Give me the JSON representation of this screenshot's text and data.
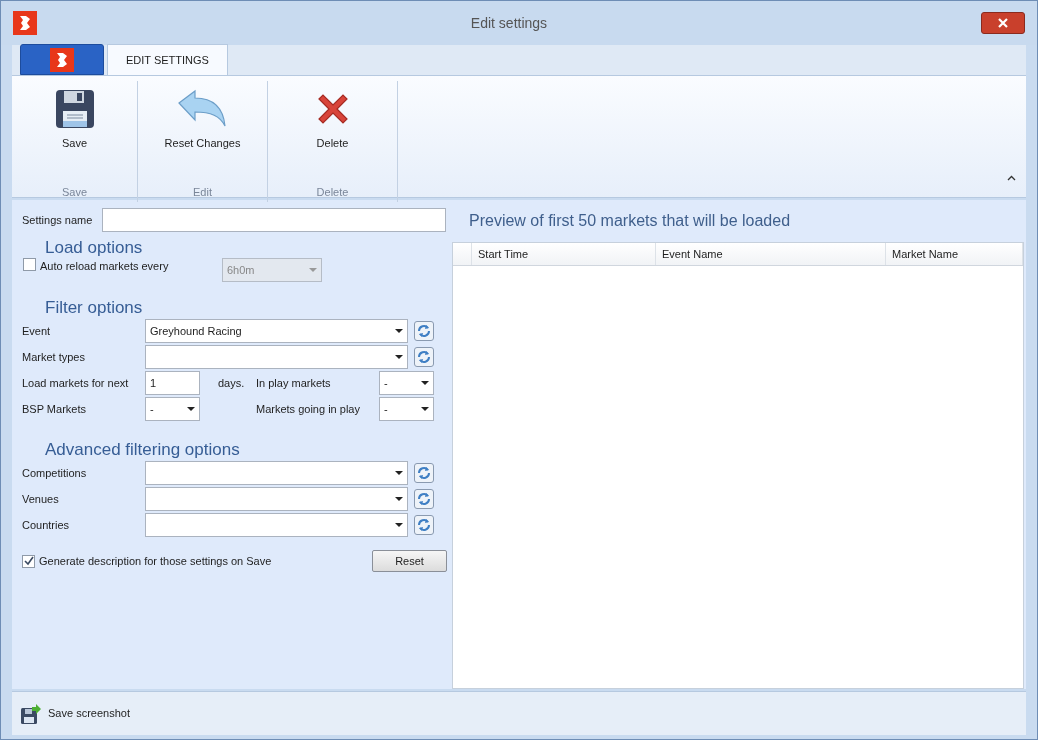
{
  "window": {
    "title": "Edit settings"
  },
  "tabs": [
    {
      "label": "EDIT SETTINGS",
      "selected": true
    }
  ],
  "ribbon": [
    {
      "label": "Save",
      "button": {
        "label": "Save"
      }
    },
    {
      "label": "Edit",
      "button": {
        "label": "Reset Changes"
      }
    },
    {
      "label": "Delete",
      "button": {
        "label": "Delete"
      }
    }
  ],
  "settings_name": {
    "label": "Settings name"
  },
  "load_options": {
    "title": "Load options",
    "auto_reload": {
      "label": "Auto reload markets every",
      "checked": false,
      "value": "6h0m",
      "disabled": true
    }
  },
  "filter_options": {
    "title": "Filter options",
    "combos": [
      {
        "label": "Event",
        "value": "Greyhound Racing"
      },
      {
        "label": "Market types"
      }
    ],
    "load_next": {
      "label": "Load markets for next",
      "value": "1",
      "unit": "days."
    },
    "bsp": {
      "label": "BSP Markets",
      "value": "-"
    },
    "in_play": {
      "label": "In play markets",
      "value": "-"
    },
    "going_in_play": {
      "label": "Markets going in play",
      "value": "-"
    }
  },
  "advanced": {
    "title": "Advanced filtering options",
    "combos": [
      {
        "label": "Competitions"
      },
      {
        "label": "Venues"
      },
      {
        "label": "Countries"
      }
    ]
  },
  "generate_description": {
    "label": "Generate description for those settings on Save",
    "checked": true
  },
  "reset_button": "Reset",
  "preview": {
    "title": "Preview of first 50 markets that will be loaded",
    "columns": [
      "Start Time",
      "Event Name",
      "Market Name"
    ]
  },
  "status_bar": {
    "button": "Save screenshot"
  }
}
